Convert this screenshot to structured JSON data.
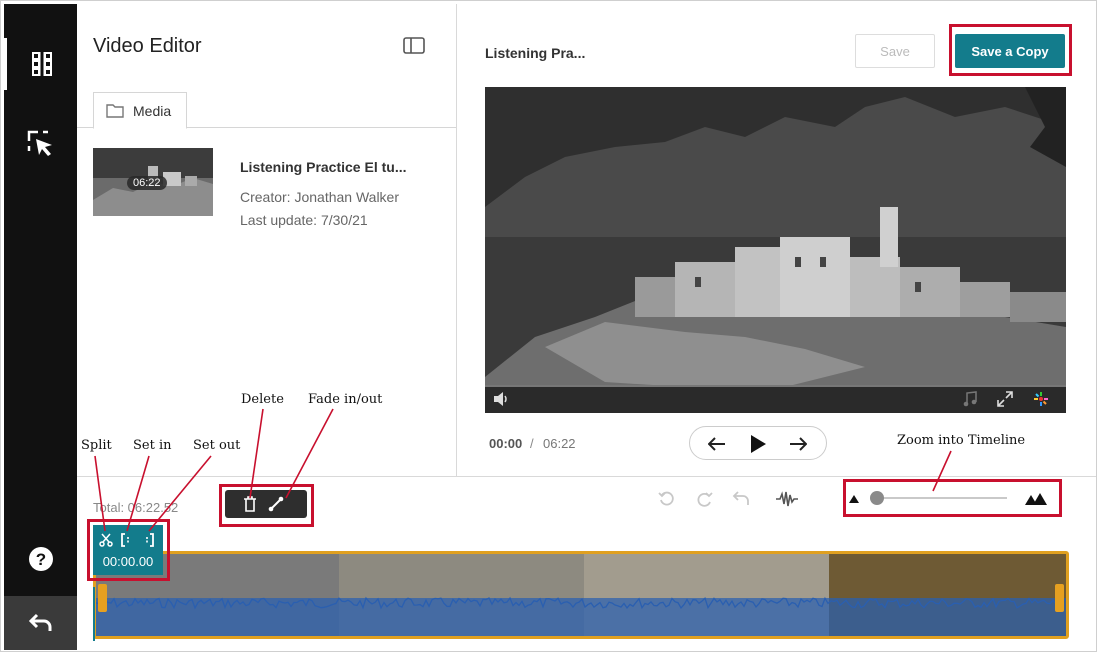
{
  "editor": {
    "title": "Video Editor",
    "media_tab": "Media"
  },
  "media_item": {
    "title": "Listening Practice El tu...",
    "duration": "06:22",
    "creator": "Creator: Jonathan Walker",
    "last_update": "Last update: 7/30/21"
  },
  "preview": {
    "title": "Listening Pra...",
    "save_label": "Save",
    "save_copy_label": "Save a Copy",
    "current_time": "00:00",
    "separator": "/",
    "total_time": "06:22"
  },
  "timeline": {
    "total": "Total: 06:22.52",
    "playhead_time": "00:00.00",
    "zoom_level": 0.0
  },
  "annotations": {
    "split": "Split",
    "set_in": "Set in",
    "set_out": "Set out",
    "delete": "Delete",
    "fade": "Fade in/out",
    "zoom": "Zoom into Timeline"
  },
  "colors": {
    "accent": "#137c8c",
    "highlight": "#c8102e",
    "timeline_border": "#e0a020",
    "waveform": "#2a5fb0"
  }
}
